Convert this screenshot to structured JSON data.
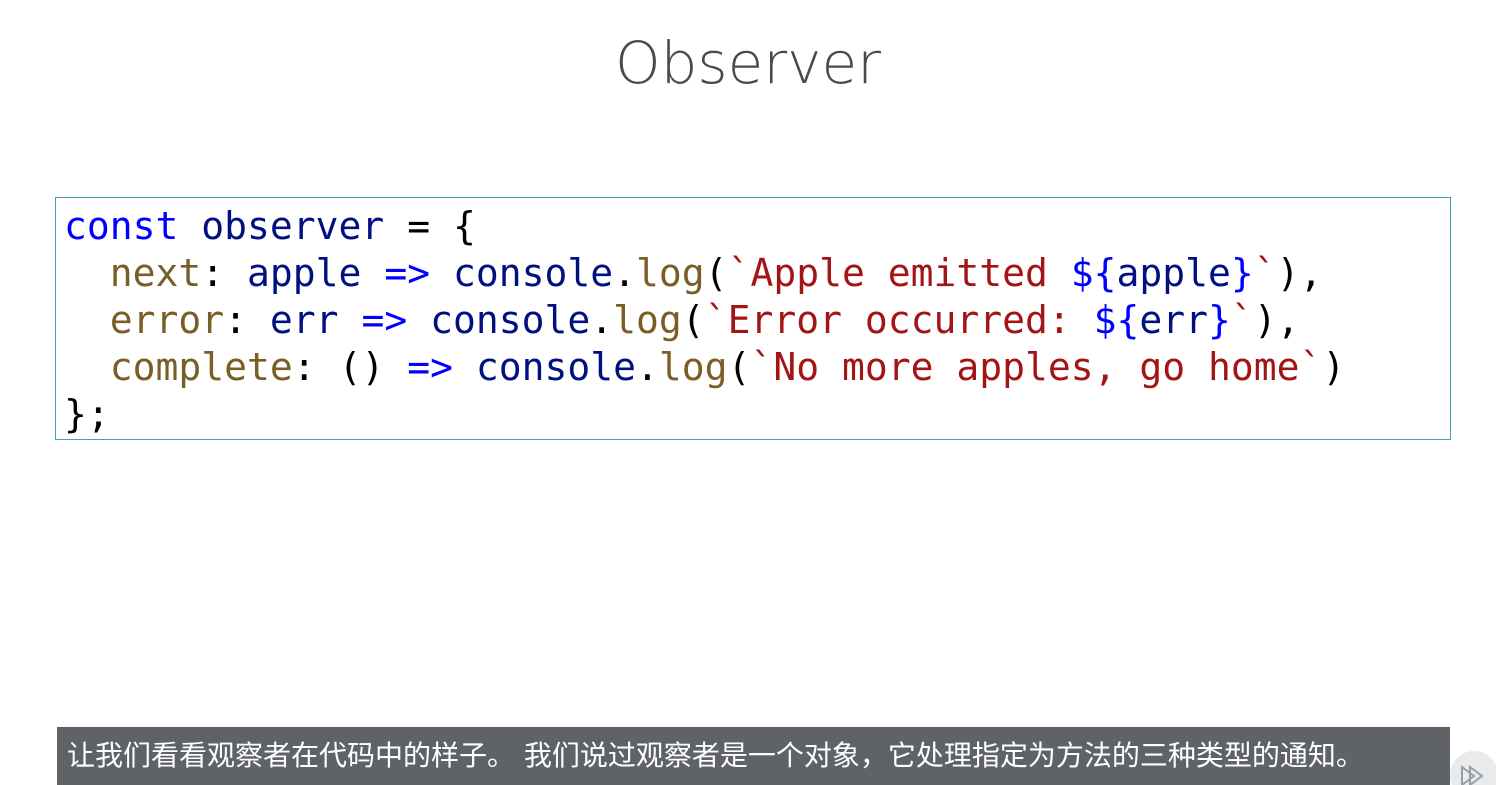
{
  "slide": {
    "title": "Observer"
  },
  "code": {
    "line1": {
      "kw": "const",
      "name": "observer",
      "rest": " = {"
    },
    "line2": {
      "prop": "next",
      "colon": ": ",
      "param": "apple",
      "arrow": "=>",
      "obj": "console",
      "dot": ".",
      "fn": "log",
      "open": "(",
      "str1": "`Apple emitted ",
      "tpl_open": "${",
      "tpl_var": "apple",
      "tpl_close": "}",
      "str2": "`",
      "close": "),"
    },
    "line3": {
      "prop": "error",
      "colon": ": ",
      "param": "err",
      "arrow": "=>",
      "obj": "console",
      "dot": ".",
      "fn": "log",
      "open": "(",
      "str1": "`Error occurred: ",
      "tpl_open": "${",
      "tpl_var": "err",
      "tpl_close": "}",
      "str2": "`",
      "close": "),"
    },
    "line4": {
      "prop": "complete",
      "colon": ": ",
      "params": "()",
      "arrow": "=>",
      "obj": "console",
      "dot": ".",
      "fn": "log",
      "open": "(",
      "str": "`No more apples, go home`",
      "close": ")"
    },
    "line5": "};"
  },
  "subtitle": {
    "text": "让我们看看观察者在代码中的样子。 我们说过观察者是一个对象，它处理指定为方法的三种类型的通知。"
  },
  "controls": {
    "play_icon": "play-icon"
  }
}
